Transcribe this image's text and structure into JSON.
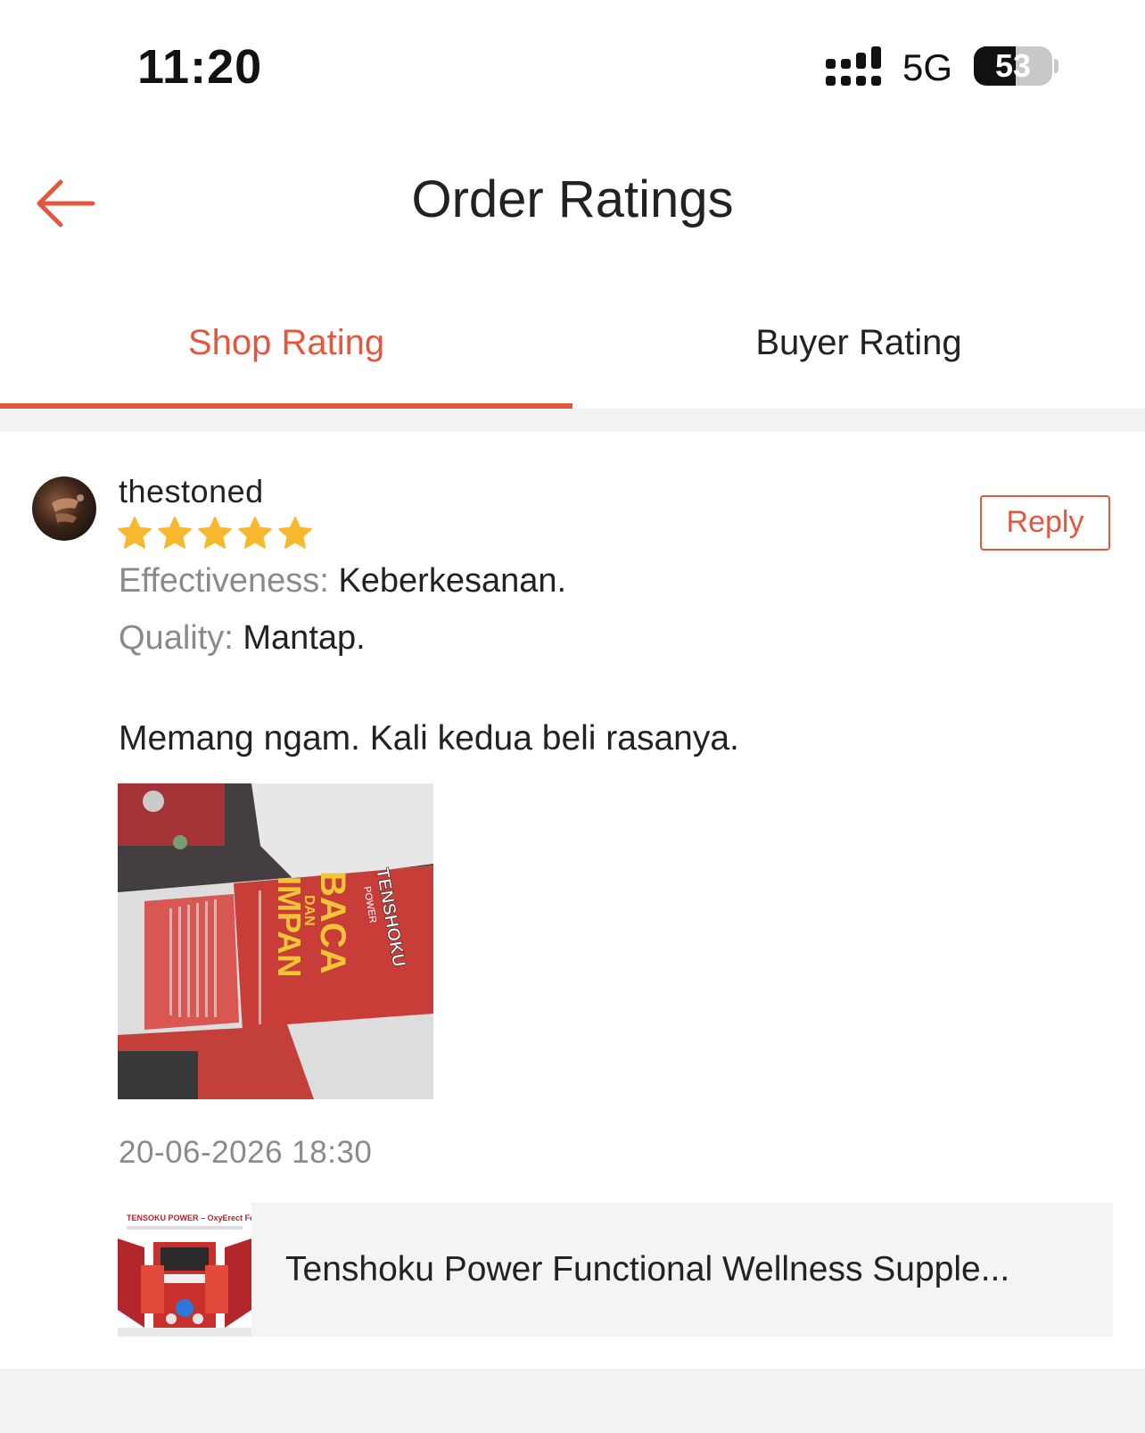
{
  "status_bar": {
    "time": "11:20",
    "network": "5G",
    "battery": "53",
    "battery_level": 0.53
  },
  "header": {
    "title": "Order Ratings",
    "back_icon": "arrow-left-icon"
  },
  "tabs": [
    {
      "label": "Shop Rating",
      "active": true
    },
    {
      "label": "Buyer Rating",
      "active": false
    }
  ],
  "review": {
    "username": "thestoned",
    "stars": 5,
    "reply_label": "Reply",
    "attributes": [
      {
        "label": "Effectiveness:",
        "value": "Keberkesanan."
      },
      {
        "label": "Quality:",
        "value": "Mantap."
      }
    ],
    "comment": "Memang ngam. Kali kedua beli rasanya.",
    "photo_text": {
      "line1": "BACA",
      "line2": "DAN",
      "line3": "IMPAN",
      "brand": "TENSHOKU",
      "brand_sub": "POWER"
    },
    "timestamp": "20-06-2026 18:30",
    "product": {
      "name": "Tenshoku Power Functional Wellness Supple...",
      "thumb_caption": "TENSOKU POWER – OxyErect Formula"
    }
  },
  "colors": {
    "accent": "#e2583e",
    "star": "#f7b82e",
    "muted_text": "#8a8a8a",
    "page_bg": "#f2f2f2"
  }
}
